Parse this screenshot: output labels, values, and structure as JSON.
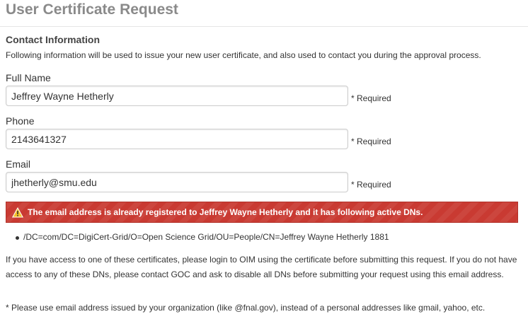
{
  "page": {
    "title": "User Certificate Request"
  },
  "contact": {
    "heading": "Contact Information",
    "description": "Following information will be used to issue your new user certificate, and also used to contact you during the approval process."
  },
  "fields": {
    "full_name": {
      "label": "Full Name",
      "value": "Jeffrey Wayne Hetherly",
      "required_note": "* Required"
    },
    "phone": {
      "label": "Phone",
      "value": "2143641327",
      "required_note": "* Required"
    },
    "email": {
      "label": "Email",
      "value": "jhetherly@smu.edu",
      "required_note": "* Required"
    }
  },
  "alert": {
    "icon": "warning-icon",
    "color": "#c93a32",
    "message": "The email address is already registered to Jeffrey Wayne Hetherly and it has following active DNs."
  },
  "dns": [
    "/DC=com/DC=DigiCert-Grid/O=Open Science Grid/OU=People/CN=Jeffrey Wayne Hetherly 1881"
  ],
  "info": {
    "paragraph": "If you have access to one of these certificates, please login to OIM using the certificate before submitting this request. If you do not have access to any of these DNs, please contact GOC and ask to disable all DNs before submitting your request using this email address.",
    "footnote": "* Please use email address issued by your organization (like @fnal.gov), instead of a personal addresses like gmail, yahoo, etc."
  }
}
